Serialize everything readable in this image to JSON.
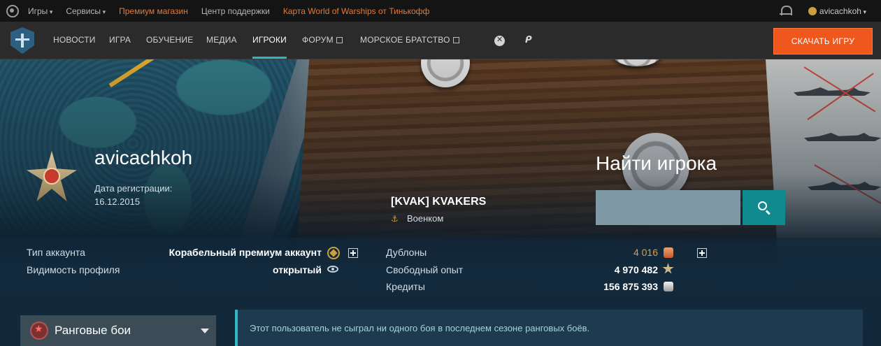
{
  "topbar": {
    "games": "Игры",
    "services": "Сервисы",
    "premium_shop": "Премиум магазин",
    "support": "Центр поддержки",
    "card": "Карта World of Warships от Тинькофф",
    "username": "avicachkoh",
    "colors": {
      "orange": "#e07b3c",
      "bg": "#141414"
    }
  },
  "nav": {
    "items": [
      "НОВОСТИ",
      "ИГРА",
      "ОБУЧЕНИЕ",
      "МЕДИА",
      "ИГРОКИ",
      "ФОРУМ",
      "МОРСКОЕ БРАТСТВО"
    ],
    "active": "ИГРОКИ",
    "download": "СКАЧАТЬ ИГРУ",
    "icons": [
      "wows-logo-icon",
      "xbox-icon",
      "playstation-icon",
      "external-link-icon"
    ],
    "colors": {
      "accent": "#2bb8c4",
      "download": "#f0571d"
    }
  },
  "profile": {
    "nickname": "avicachkoh",
    "reg_label": "Дата регистрации:",
    "reg_date": "16.12.2015",
    "clan": "[KVAK] KVAKERS",
    "clan_role": "Военком"
  },
  "search": {
    "title": "Найти игрока",
    "value": "",
    "placeholder": ""
  },
  "account": {
    "type_label": "Тип аккаунта",
    "type_value": "Корабельный премиум аккаунт",
    "visibility_label": "Видимость профиля",
    "visibility_value": "открытый"
  },
  "currency": {
    "doubloons_label": "Дублоны",
    "doubloons_value": "4 016",
    "free_xp_label": "Свободный опыт",
    "free_xp_value": "4 970 482",
    "credits_label": "Кредиты",
    "credits_value": "156 875 393"
  },
  "ranked": {
    "label": "Ранговые бои",
    "notice": "Этот пользователь не сыграл ни одного боя в последнем сезоне ранговых боёв."
  }
}
